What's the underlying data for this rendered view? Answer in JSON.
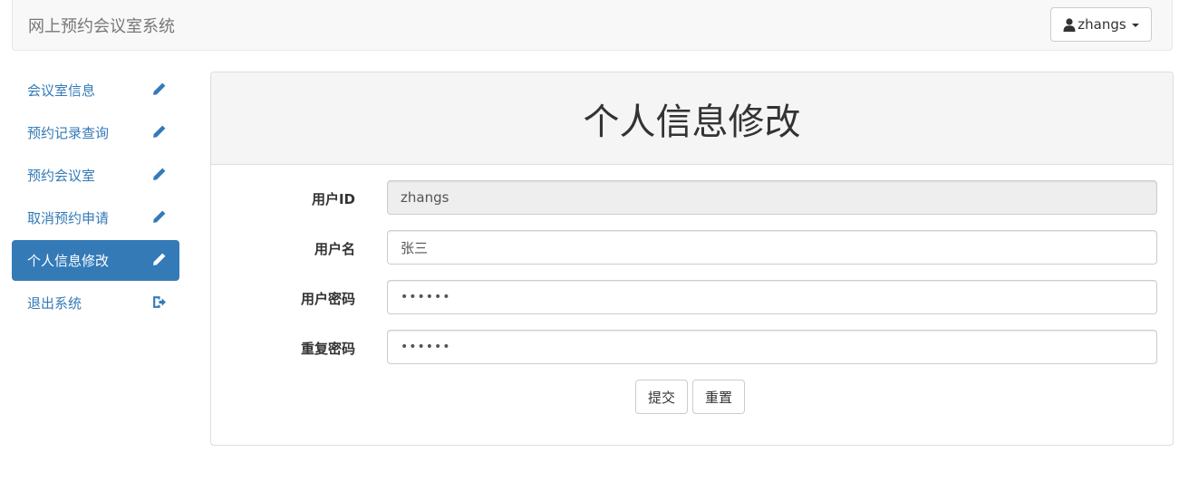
{
  "header": {
    "brand": "网上预约会议室系统",
    "user_label": "zhangs"
  },
  "sidebar": {
    "items": [
      {
        "label": "会议室信息",
        "icon": "pencil-icon",
        "active": false
      },
      {
        "label": "预约记录查询",
        "icon": "pencil-icon",
        "active": false
      },
      {
        "label": "预约会议室",
        "icon": "pencil-icon",
        "active": false
      },
      {
        "label": "取消预约申请",
        "icon": "pencil-icon",
        "active": false
      },
      {
        "label": "个人信息修改",
        "icon": "pencil-icon",
        "active": true
      },
      {
        "label": "退出系统",
        "icon": "logout-icon",
        "active": false
      }
    ]
  },
  "main": {
    "title": "个人信息修改",
    "fields": {
      "user_id": {
        "label": "用户ID",
        "value": "zhangs"
      },
      "username": {
        "label": "用户名",
        "value": "张三"
      },
      "password": {
        "label": "用户密码",
        "value": "••••••"
      },
      "password_repeat": {
        "label": "重复密码",
        "value": "••••••"
      }
    },
    "submit_label": "提交",
    "reset_label": "重置"
  },
  "colors": {
    "accent": "#337ab7",
    "navbar_bg": "#f8f8f8",
    "panel_head_bg": "#f5f5f5",
    "readonly_bg": "#eeeeee"
  }
}
